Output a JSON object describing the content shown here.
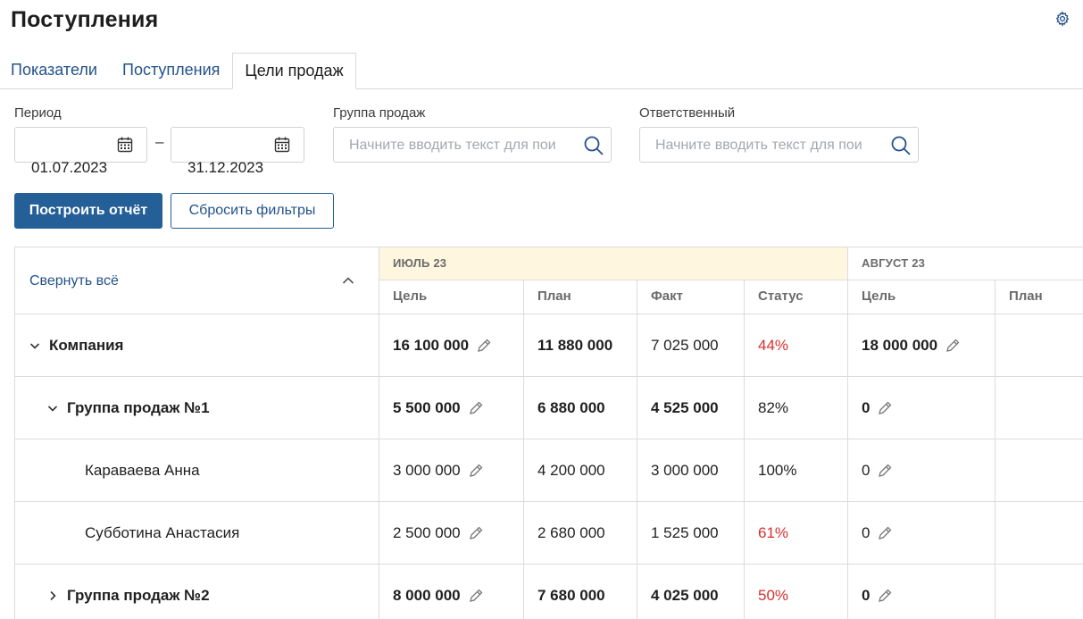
{
  "page": {
    "title": "Поступления"
  },
  "tabs": [
    {
      "label": "Показатели"
    },
    {
      "label": "Поступления"
    },
    {
      "label": "Цели продаж",
      "active": true
    }
  ],
  "filters": {
    "period_label": "Период",
    "date_from": "01.07.2023",
    "date_to": "31.12.2023",
    "separator": "–",
    "group_label": "Группа продаж",
    "group_placeholder": "Начните вводить текст для поиска",
    "responsible_label": "Ответственный",
    "responsible_placeholder": "Начните вводить текст для поиска"
  },
  "buttons": {
    "build": "Построить отчёт",
    "reset": "Сбросить фильтры"
  },
  "table": {
    "collapse_all": "Свернуть всё",
    "months": [
      {
        "label": "ИЮЛЬ 23",
        "highlight": true
      },
      {
        "label": "АВГУСТ 23"
      }
    ],
    "columns": [
      "Цель",
      "План",
      "Факт",
      "Статус",
      "Цель",
      "План"
    ],
    "rows": [
      {
        "name": "Компания",
        "bold": true,
        "level": 0,
        "chevron": "down",
        "goal": "16 100 000",
        "plan": "11 880 000",
        "fact": "7 025 000",
        "status": "44%",
        "status_red": true,
        "aug_goal": "18 000 000"
      },
      {
        "name": "Группа продаж №1",
        "bold": true,
        "level": 1,
        "chevron": "down",
        "goal": "5 500 000",
        "plan": "6 880 000",
        "fact": "4 525 000",
        "status": "82%",
        "status_red": false,
        "aug_goal": "0"
      },
      {
        "name": "Караваева Анна",
        "bold": false,
        "level": 2,
        "chevron": "none",
        "goal": "3 000 000",
        "plan": "4 200 000",
        "fact": "3 000 000",
        "status": "100%",
        "status_red": false,
        "aug_goal": "0"
      },
      {
        "name": "Субботина Анастасия",
        "bold": false,
        "level": 2,
        "chevron": "none",
        "goal": "2 500 000",
        "plan": "2 680 000",
        "fact": "1 525 000",
        "status": "61%",
        "status_red": true,
        "aug_goal": "0"
      },
      {
        "name": "Группа продаж №2",
        "bold": true,
        "level": 1,
        "chevron": "right",
        "goal": "8 000 000",
        "plan": "7 680 000",
        "fact": "4 025 000",
        "status": "50%",
        "status_red": true,
        "aug_goal": "0"
      }
    ]
  },
  "colors": {
    "accent": "#245f98",
    "link": "#24528a",
    "danger": "#d6302e",
    "month_highlight": "#fff6e0"
  },
  "icons": {
    "settings": "gear-icon",
    "calendar": "calendar-icon",
    "search": "search-icon",
    "edit": "pencil-icon",
    "expand": "chevron-down-icon",
    "collapse": "chevron-right-icon"
  }
}
